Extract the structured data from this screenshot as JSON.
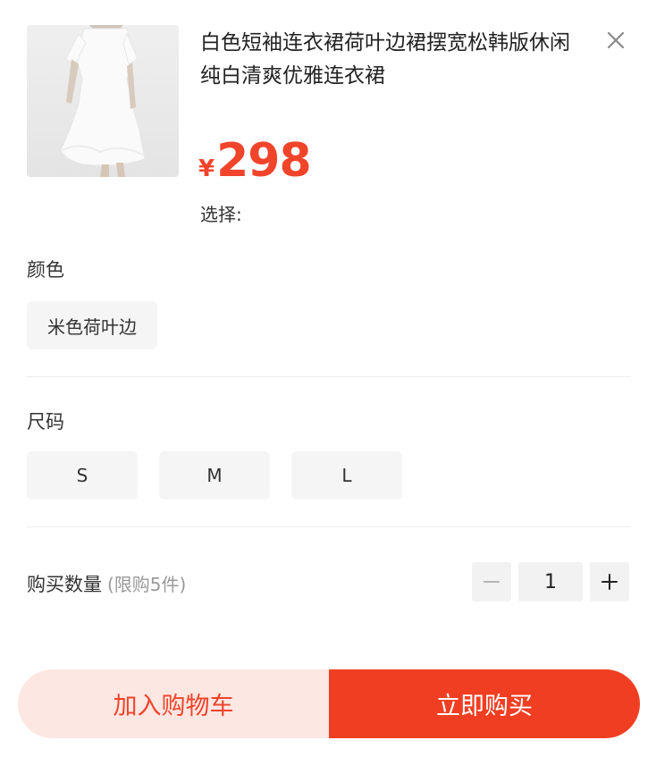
{
  "product": {
    "title": "白色短袖连衣裙荷叶边裙摆宽松韩版休闲纯白清爽优雅连衣裙",
    "currency": "¥",
    "price": "298",
    "select_label": "选择:"
  },
  "color": {
    "title": "颜色",
    "options": [
      "米色荷叶边"
    ]
  },
  "size": {
    "title": "尺码",
    "options": [
      "S",
      "M",
      "L"
    ]
  },
  "quantity": {
    "label": "购买数量",
    "limit": "(限购5件)",
    "value": "1"
  },
  "actions": {
    "add_to_cart": "加入购物车",
    "buy_now": "立即购买"
  },
  "colors": {
    "accent": "#f0442b",
    "cart_bg": "#fde7e2"
  }
}
